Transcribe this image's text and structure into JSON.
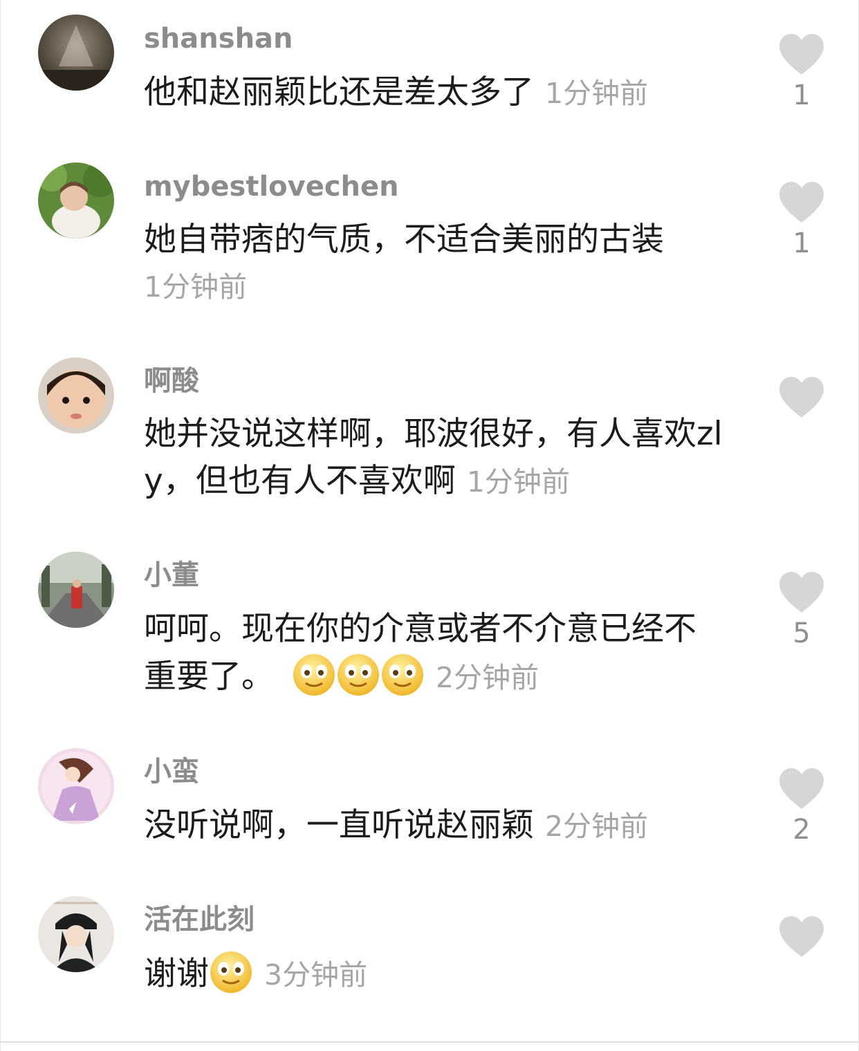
{
  "comments": [
    {
      "username": "shanshan",
      "text": "他和赵丽颖比还是差太多了",
      "time": "1分钟前",
      "likes": "1",
      "avatar": "dim-room-photo",
      "emoji_count": 0
    },
    {
      "username": "mybestlovechen",
      "text": "她自带痞的气质，不适合美丽的古装",
      "time": "1分钟前",
      "likes": "1",
      "avatar": "child-on-grass-photo",
      "emoji_count": 0
    },
    {
      "username": "啊酸",
      "text": "她并没说这样啊，耶波很好，有人喜欢zly，但也有人不喜欢啊",
      "time": "1分钟前",
      "likes": "",
      "avatar": "child-face-photo",
      "emoji_count": 0
    },
    {
      "username": "小董",
      "text": "呵呵。现在你的介意或者不介意已经不重要了。",
      "time": "2分钟前",
      "likes": "5",
      "avatar": "street-photo",
      "emoji_count": 3
    },
    {
      "username": "小蛮",
      "text": "没听说啊，一直听说赵丽颖",
      "time": "2分钟前",
      "likes": "2",
      "avatar": "anime-girl-illustration",
      "emoji_count": 0
    },
    {
      "username": "活在此刻",
      "text": "谢谢",
      "time": "3分钟前",
      "likes": "",
      "avatar": "girl-in-cap-photo",
      "emoji_count": 1
    }
  ],
  "icons": {
    "like": "heart-icon",
    "emoji": "smiling-face-emoji"
  },
  "colors": {
    "username": "#8c8c8c",
    "text": "#1c1c1c",
    "time": "#a6a6a6",
    "heart": "#d6d6d6",
    "count": "#8f8f8f"
  }
}
